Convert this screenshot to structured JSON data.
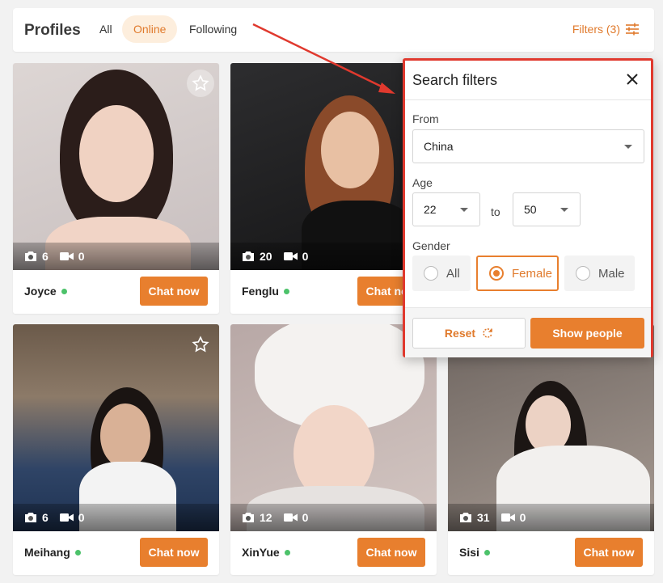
{
  "header": {
    "title": "Profiles",
    "tabs": [
      {
        "label": "All",
        "active": false
      },
      {
        "label": "Online",
        "active": true
      },
      {
        "label": "Following",
        "active": false
      }
    ],
    "filters_label": "Filters (3)",
    "filters_icon": "sliders-icon"
  },
  "colors": {
    "accent": "#e87f2e",
    "online": "#4cc26a",
    "highlight_border": "#e0392e"
  },
  "profiles": [
    {
      "name": "Joyce",
      "photos": "6",
      "videos": "0",
      "online": true,
      "favorite": true,
      "chat_label": "Chat now"
    },
    {
      "name": "Fenglu",
      "photos": "20",
      "videos": "0",
      "online": true,
      "favorite": false,
      "chat_label": "Chat now"
    },
    {
      "name": "Meihang",
      "photos": "6",
      "videos": "0",
      "online": true,
      "favorite": false,
      "chat_label": "Chat now"
    },
    {
      "name": "XinYue",
      "photos": "12",
      "videos": "0",
      "online": true,
      "favorite": false,
      "chat_label": "Chat now"
    },
    {
      "name": "Sisi",
      "photos": "31",
      "videos": "0",
      "online": true,
      "favorite": false,
      "chat_label": "Chat now"
    }
  ],
  "search_filters": {
    "title": "Search filters",
    "from_label": "From",
    "from_value": "China",
    "age_label": "Age",
    "age_min": "22",
    "age_to": "to",
    "age_max": "50",
    "gender_label": "Gender",
    "gender_options": [
      {
        "label": "All",
        "selected": false
      },
      {
        "label": "Female",
        "selected": true
      },
      {
        "label": "Male",
        "selected": false
      }
    ],
    "reset_label": "Reset",
    "show_label": "Show people"
  }
}
